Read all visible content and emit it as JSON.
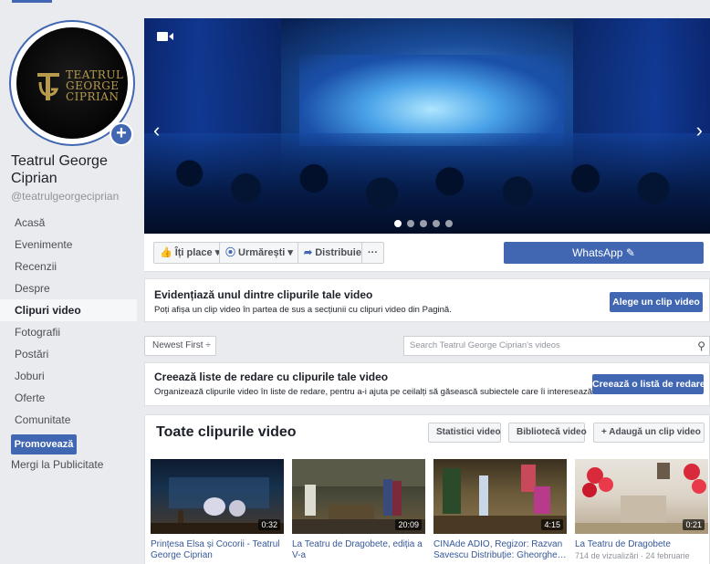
{
  "page": {
    "name": "Teatrul George Ciprian",
    "handle": "@teatrulgeorgeciprian",
    "logo_lines": [
      "TEATRUL",
      "GEORGE",
      "CIPRIAN"
    ]
  },
  "nav": {
    "items": [
      "Acasă",
      "Evenimente",
      "Recenzii",
      "Despre",
      "Clipuri video",
      "Fotografii",
      "Postări",
      "Joburi",
      "Oferte",
      "Comunitate"
    ],
    "active": "Clipuri video",
    "promote_label": "Promovează",
    "ads_link": "Mergi la Publicitate"
  },
  "actions": {
    "like": "Îți place",
    "follow": "Urmărești",
    "share": "Distribuie",
    "more": "···",
    "whatsapp": "WhatsApp"
  },
  "featured": {
    "title": "Evidențiază unul dintre clipurile tale video",
    "subtitle": "Poți afișa un clip video în partea de sus a secțiunii cu clipuri video din Pagină.",
    "button": "Alege un clip video"
  },
  "filter": {
    "sort": "Newest First ÷",
    "search_placeholder": "Search Teatrul George Ciprian's videos"
  },
  "playlist": {
    "title": "Creează liste de redare cu clipurile tale video",
    "subtitle": "Organizează clipurile video în liste de redare, pentru a-i ajuta pe ceilalți să găsească subiectele care îi interesează.",
    "button": "Creează o listă de redare"
  },
  "videos": {
    "title": "Toate clipurile video",
    "stats_button": "Statistici video",
    "library_button": "Bibliotecă video",
    "add_button": "Adaugă un clip video",
    "items": [
      {
        "title": "Prințesa Elsa și Cocorii - Teatrul George Ciprian",
        "duration": "0:32",
        "meta": ""
      },
      {
        "title": "La Teatru de Dragobete, ediția a V-a",
        "duration": "20:09",
        "meta": ""
      },
      {
        "title": "CINAde ADIO, Regizor: Razvan Savescu Distribuție: Gheorghe…",
        "duration": "4:15",
        "meta": ""
      },
      {
        "title": "La Teatru de Dragobete",
        "duration": "0:21",
        "meta": "714 de vizualizări · 24 februarie"
      }
    ]
  },
  "colors": {
    "accent": "#4267b2",
    "background": "#e9ebee",
    "link": "#365899"
  }
}
